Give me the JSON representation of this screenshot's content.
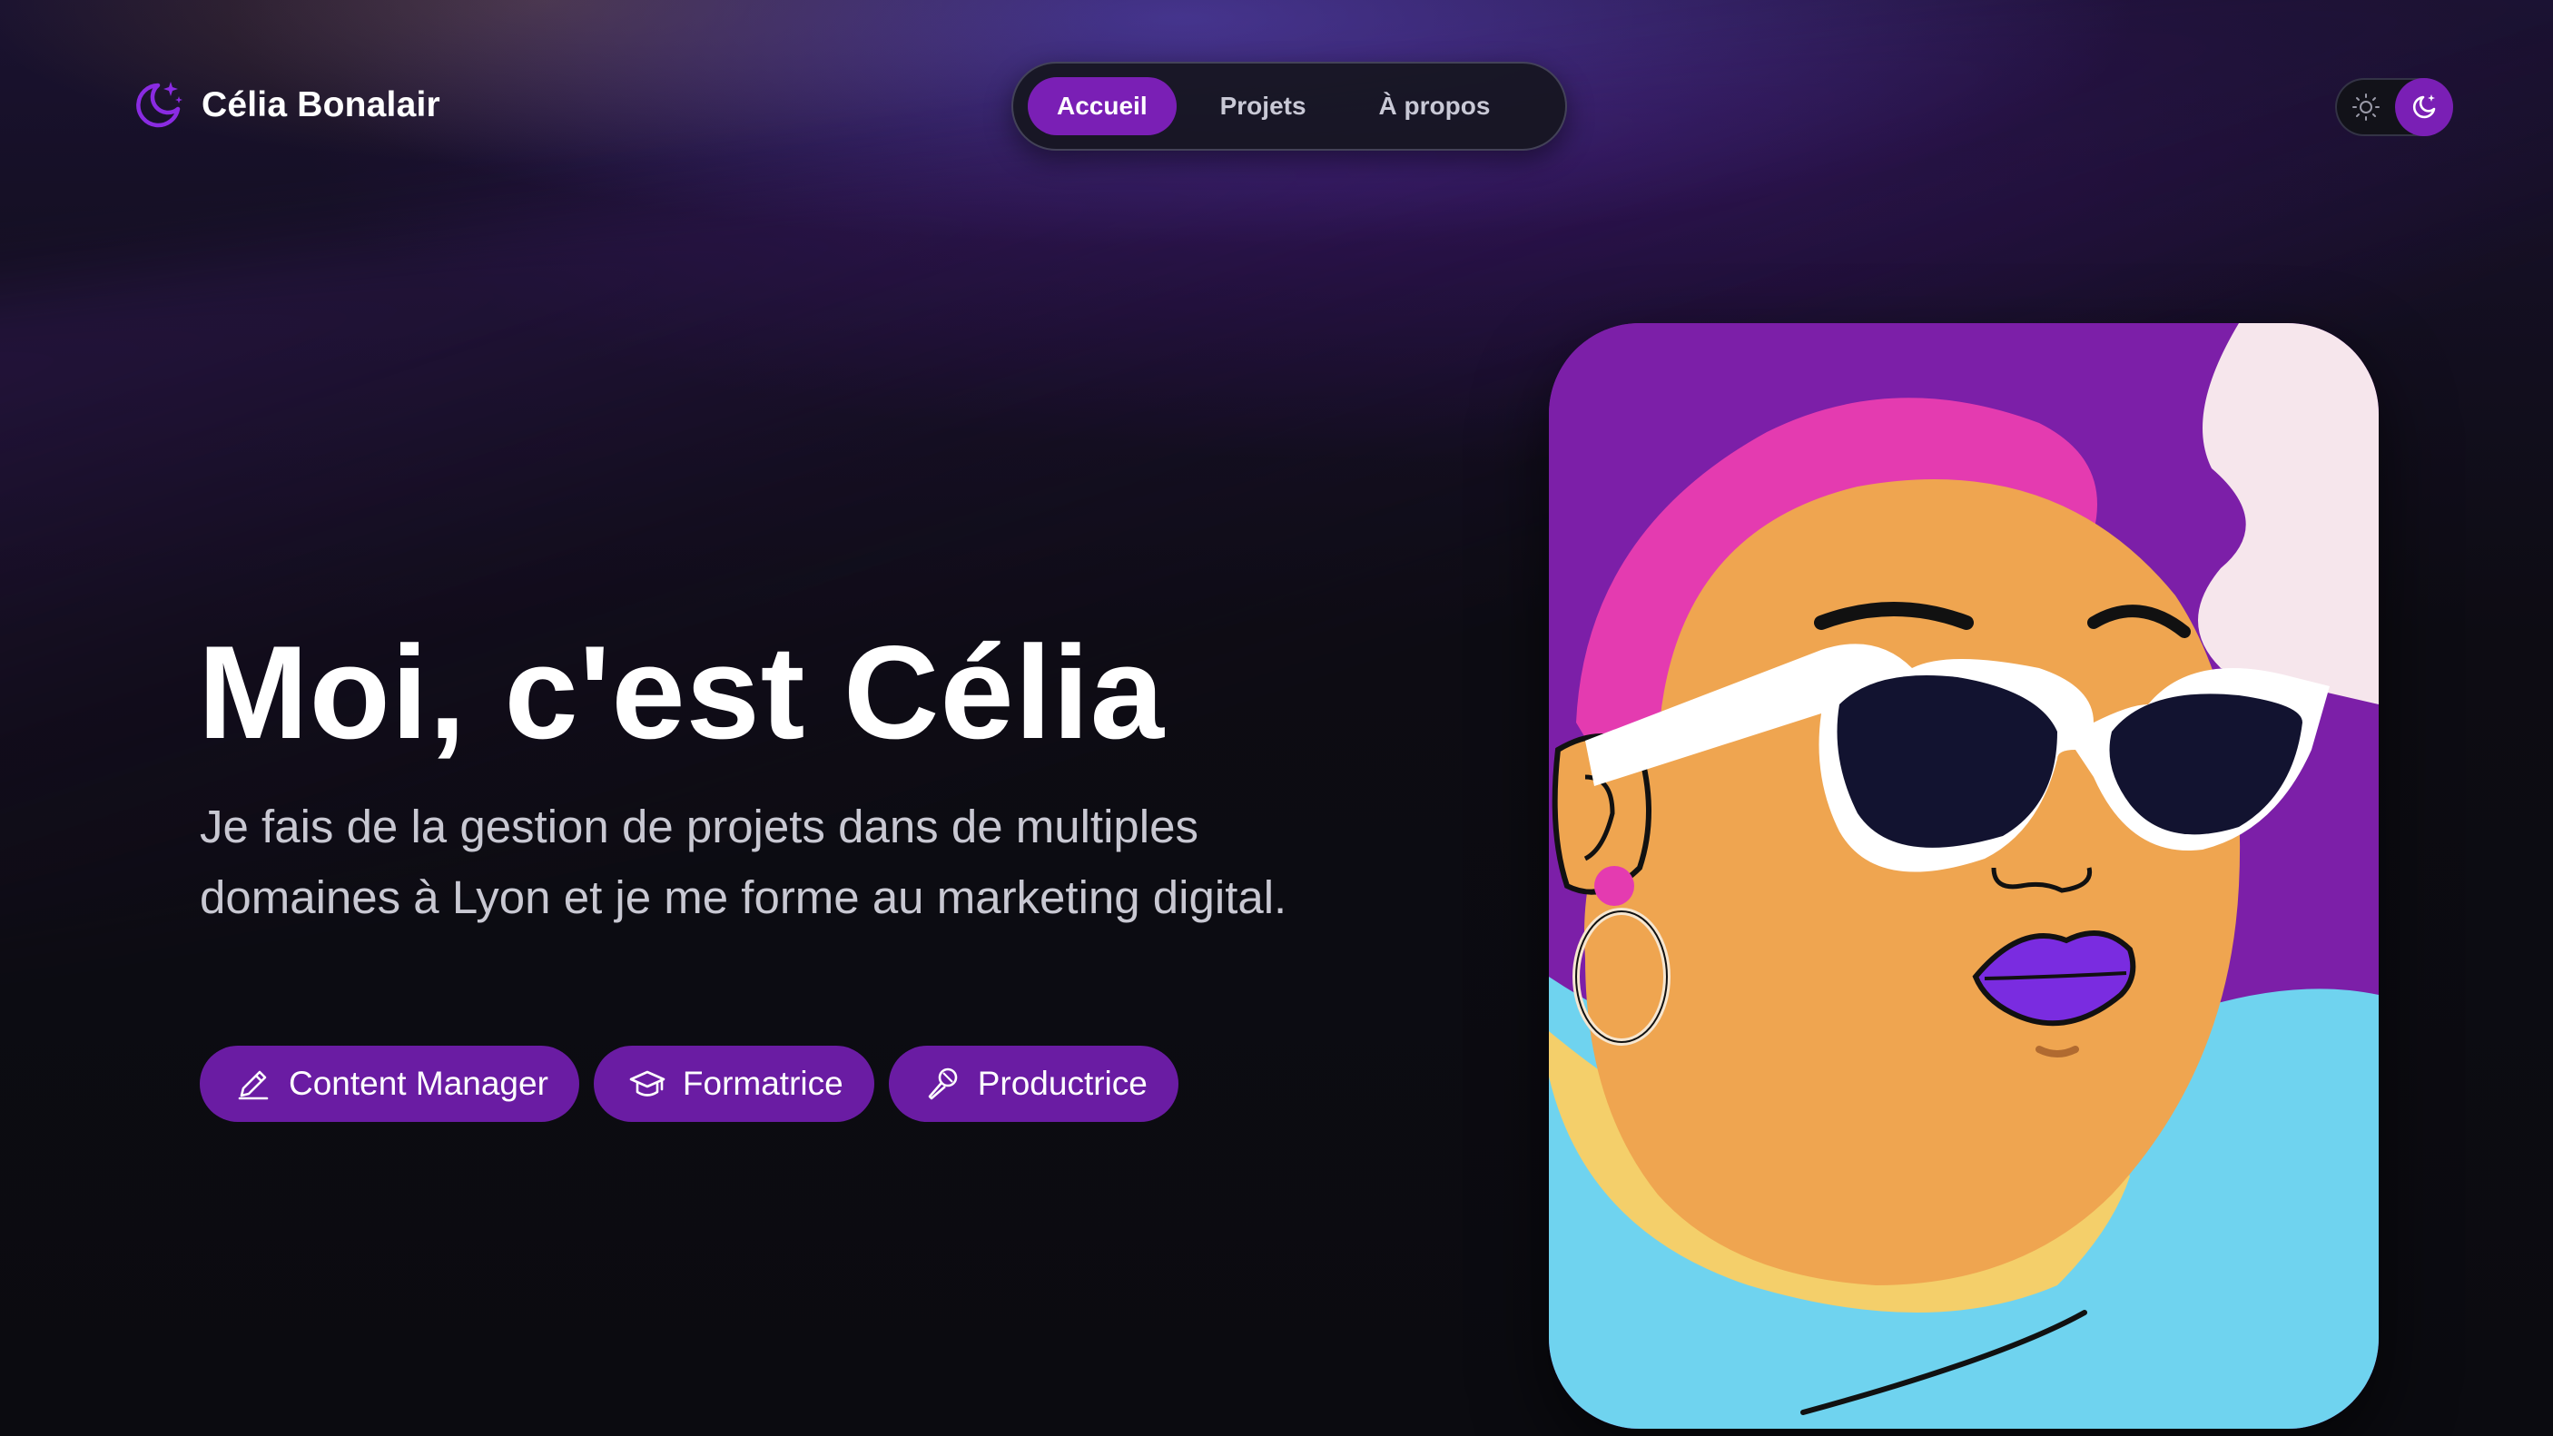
{
  "header": {
    "brand_icon": "moon-stars-icon",
    "brand_name": "Célia Bonalair"
  },
  "nav": {
    "items": [
      {
        "label": "Accueil",
        "active": true
      },
      {
        "label": "Projets",
        "active": false
      },
      {
        "label": "À propos",
        "active": false
      }
    ]
  },
  "theme_toggle": {
    "left_icon": "sun-icon",
    "right_icon": "moon-stars-icon",
    "selected": "dark"
  },
  "hero": {
    "title": "Moi, c'est Célia",
    "subtitle": "Je fais de la gestion de projets dans de multiples domaines à Lyon et je me forme au marketing digital.",
    "tags": [
      {
        "icon": "pencil-icon",
        "label": "Content Manager"
      },
      {
        "icon": "graduation-cap-icon",
        "label": "Formatrice"
      },
      {
        "icon": "microphone-icon",
        "label": "Productrice"
      }
    ]
  },
  "portrait": {
    "subject": "illustrated portrait with sunglasses and hoop earring"
  },
  "colors": {
    "accent": "#7a1fb5",
    "tag_bg": "#6a1ca3",
    "background": "#0c0c12",
    "title": "#ffffff",
    "subtitle": "#c8c8d2"
  }
}
